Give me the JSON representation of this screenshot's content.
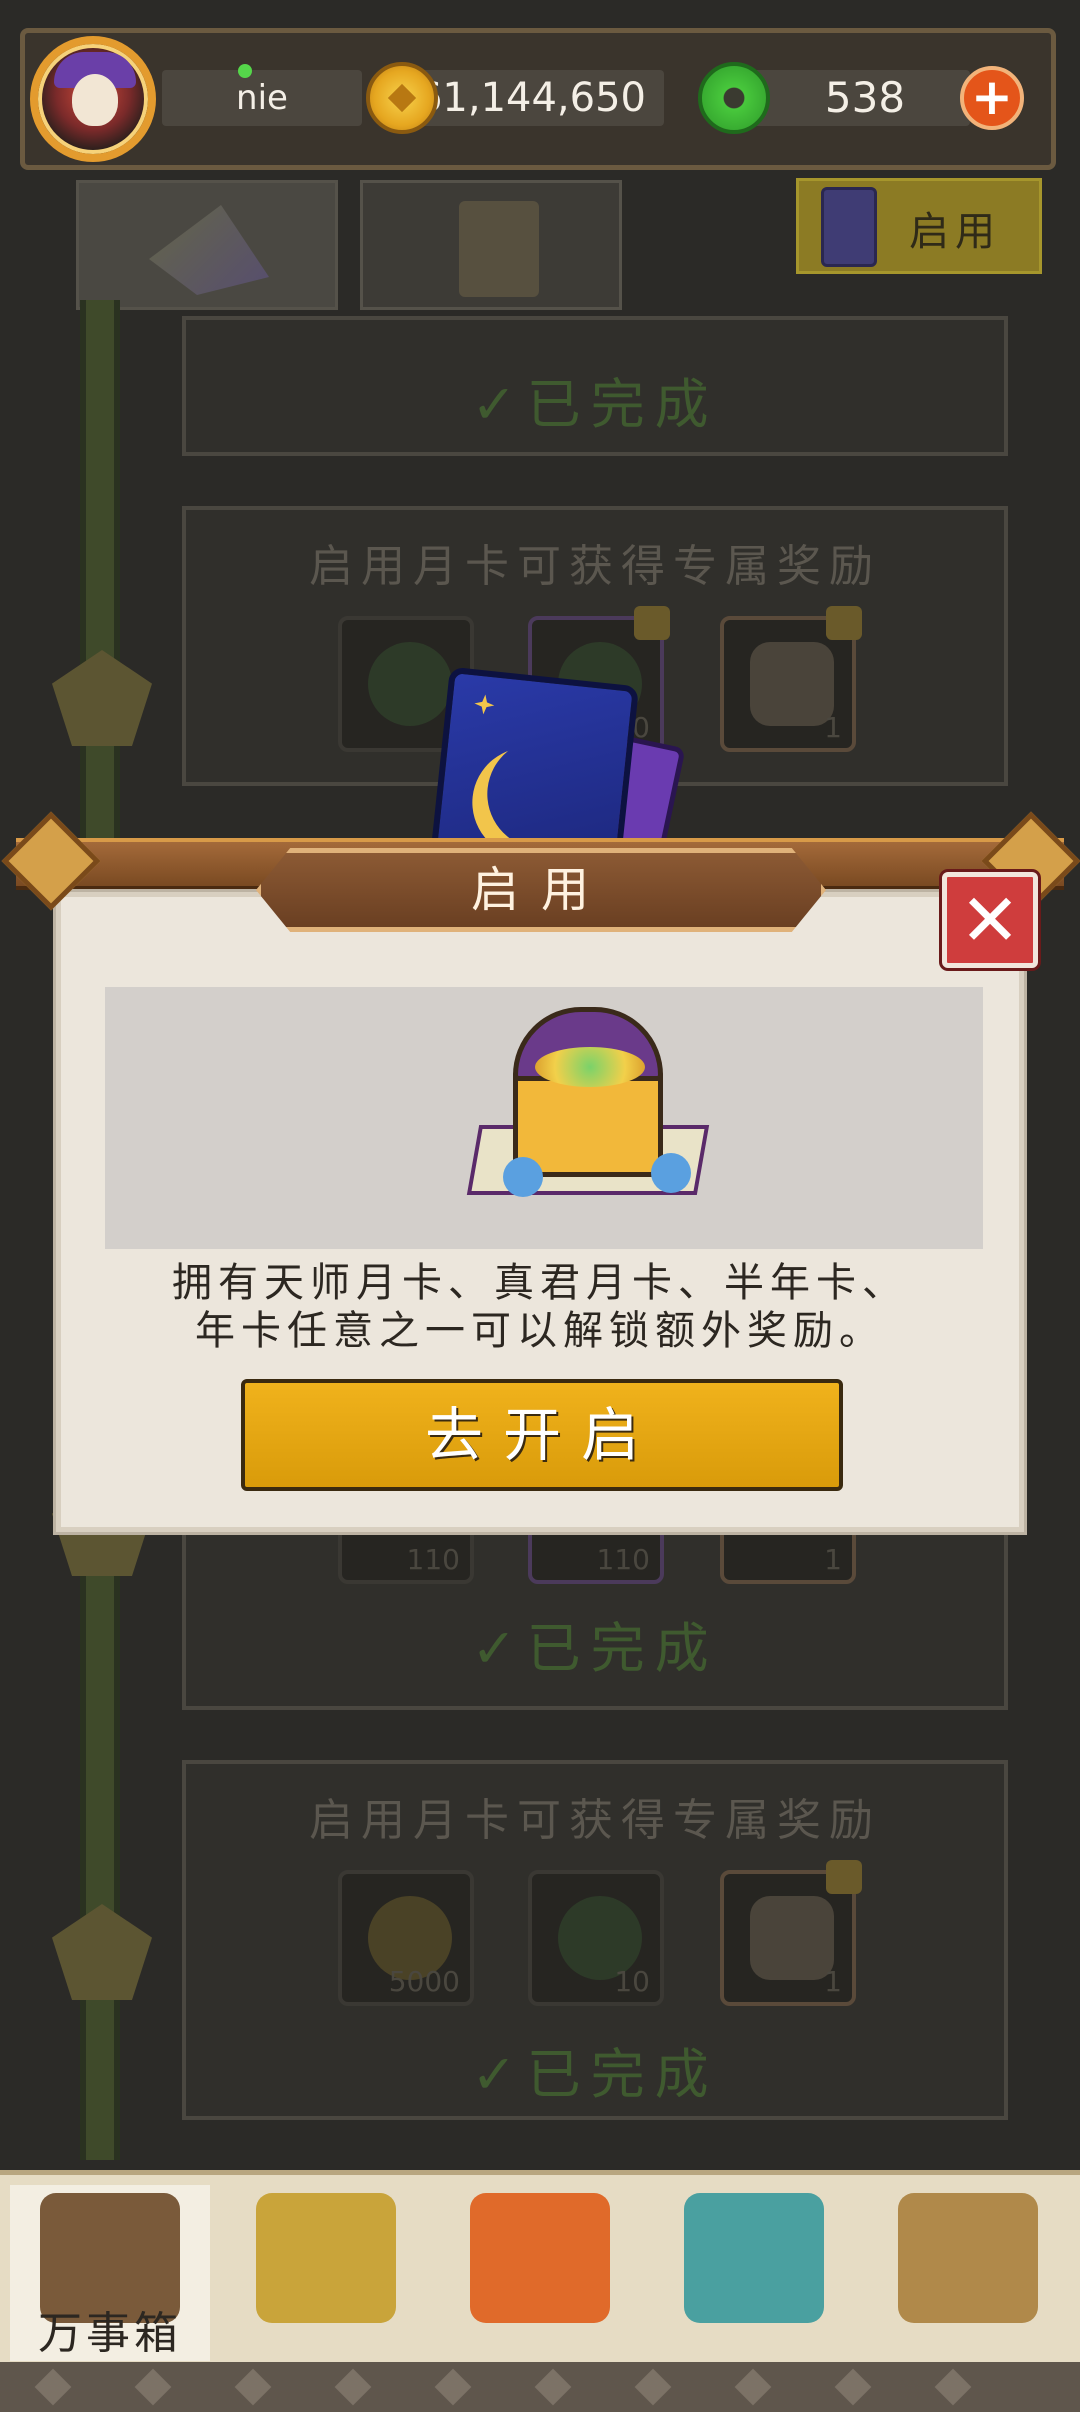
{
  "header": {
    "player_name": "nie",
    "coins": "61,144,650",
    "jade": "538"
  },
  "tabs": {
    "activate_tab": "启用"
  },
  "list": {
    "card1": {
      "done": "✓已完成"
    },
    "card2": {
      "title": "启用月卡可获得专属奖励",
      "rewards": [
        "1",
        "80",
        "1"
      ]
    },
    "card3": {
      "rewards": [
        "110",
        "110",
        "1"
      ],
      "done": "✓已完成"
    },
    "card4": {
      "title": "启用月卡可获得专属奖励",
      "rewards": [
        "5000",
        "10",
        "1"
      ],
      "done": "✓已完成"
    }
  },
  "modal": {
    "title": "启用",
    "desc_line1": "拥有天师月卡、真君月卡、半年卡、",
    "desc_line2": "年卡任意之一可以解锁额外奖励。",
    "button": "去开启",
    "close": "✕"
  },
  "nav": {
    "items": [
      {
        "label": "万事箱",
        "icon": "chest-clock-icon",
        "active": true
      },
      {
        "label": "",
        "icon": "star-trophy-icon",
        "active": false
      },
      {
        "label": "",
        "icon": "demon-gate-icon",
        "active": false
      },
      {
        "label": "",
        "icon": "market-stall-icon",
        "active": false
      },
      {
        "label": "",
        "icon": "compass-book-icon",
        "active": false
      }
    ]
  },
  "colors": {
    "accent_gold": "#f0b21c",
    "close_red": "#cf3d3d",
    "overlay_bg": "#2b2a27"
  }
}
